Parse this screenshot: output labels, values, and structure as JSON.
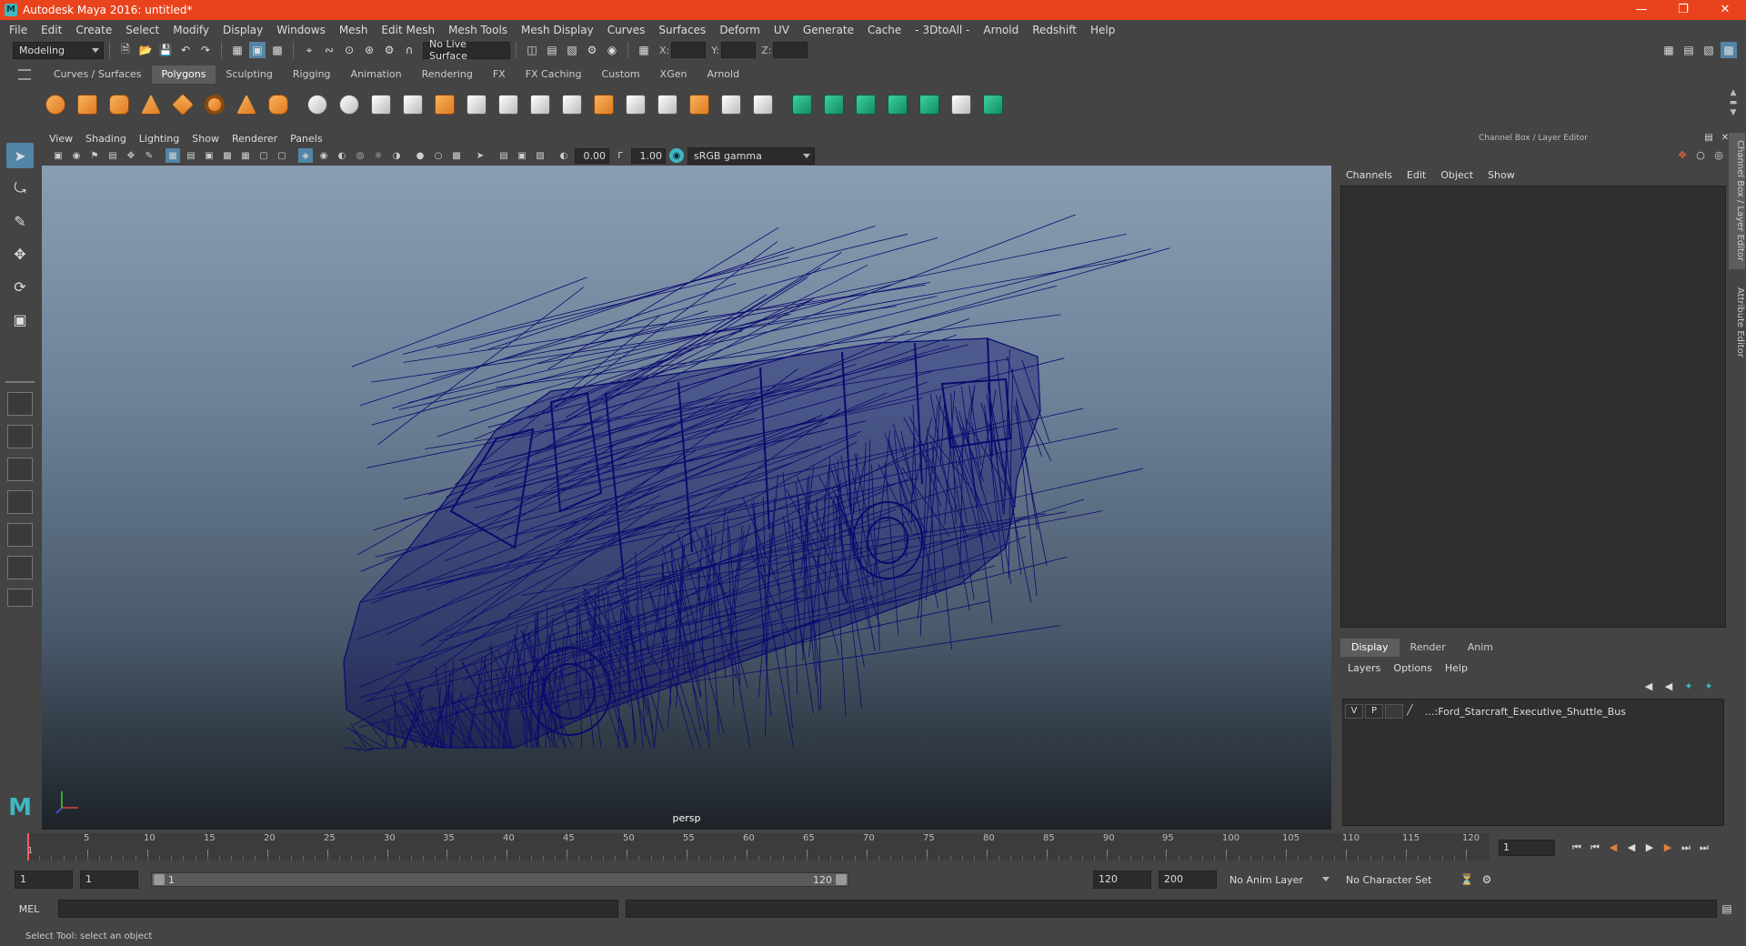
{
  "window": {
    "title": "Autodesk Maya 2016: untitled*",
    "controls": [
      "minimize",
      "maximize",
      "close"
    ]
  },
  "menubar": {
    "items": [
      "File",
      "Edit",
      "Create",
      "Select",
      "Modify",
      "Display",
      "Windows",
      "Mesh",
      "Edit Mesh",
      "Mesh Tools",
      "Mesh Display",
      "Curves",
      "Surfaces",
      "Deform",
      "UV",
      "Generate",
      "Cache",
      "- 3DtoAll -",
      "Arnold",
      "Redshift",
      "Help"
    ]
  },
  "statusline": {
    "menuset": "Modeling",
    "live_surface": "No Live Surface",
    "coord_labels": [
      "X:",
      "Y:",
      "Z:"
    ]
  },
  "shelf": {
    "tabs": [
      "Curves / Surfaces",
      "Polygons",
      "Sculpting",
      "Rigging",
      "Animation",
      "Rendering",
      "FX",
      "FX Caching",
      "Custom",
      "XGen",
      "Arnold"
    ],
    "active_tab": "Polygons"
  },
  "viewport": {
    "menu": [
      "View",
      "Shading",
      "Lighting",
      "Show",
      "Renderer",
      "Panels"
    ],
    "exposure": "0.00",
    "gamma": "1.00",
    "color_space": "sRGB gamma",
    "camera": "persp",
    "wire_color": "#0a0a6e"
  },
  "channel_box": {
    "title": "Channel Box / Layer Editor",
    "menu": [
      "Channels",
      "Edit",
      "Object",
      "Show"
    ],
    "side_tabs": [
      "Channel Box / Layer Editor",
      "Attribute Editor"
    ]
  },
  "layer_editor": {
    "tabs": [
      "Display",
      "Render",
      "Anim"
    ],
    "active_tab": "Display",
    "menu": [
      "Layers",
      "Options",
      "Help"
    ],
    "layers": [
      {
        "v": "V",
        "p": "P",
        "name": "...:Ford_Starcraft_Executive_Shuttle_Bus"
      }
    ]
  },
  "timeline": {
    "ticks": [
      "5",
      "10",
      "15",
      "20",
      "25",
      "30",
      "35",
      "40",
      "45",
      "50",
      "55",
      "60",
      "65",
      "70",
      "75",
      "80",
      "85",
      "90",
      "95",
      "100",
      "105",
      "110",
      "115",
      "120"
    ],
    "start_label": "1",
    "current_frame": "1"
  },
  "range": {
    "start_frame": "1",
    "playback_start": "1",
    "slider_start": "1",
    "slider_end": "120",
    "playback_end": "120",
    "end_frame": "200",
    "anim_layer": "No Anim Layer",
    "character_set": "No Character Set"
  },
  "command_line": {
    "label": "MEL"
  },
  "help_line": {
    "text": "Select Tool: select an object"
  }
}
